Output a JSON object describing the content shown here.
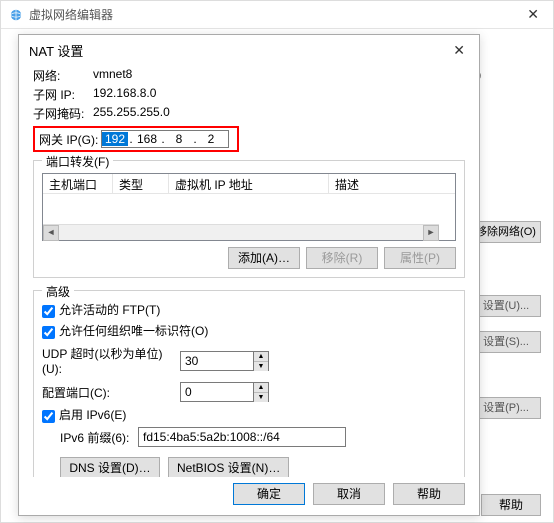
{
  "parent": {
    "title": "虚拟网络编辑器",
    "right_ghost": ".0",
    "btn_remove_net": "移除网络(O)",
    "btn_set_u": "设置(U)...",
    "btn_set_s": "设置(S)...",
    "btn_set_p": "设置(P)...",
    "btn_help": "帮助"
  },
  "modal": {
    "title": "NAT 设置",
    "close": "✕",
    "network_label": "网络:",
    "network_value": "vmnet8",
    "subnet_ip_label": "子网 IP:",
    "subnet_ip_value": "192.168.8.0",
    "subnet_mask_label": "子网掩码:",
    "subnet_mask_value": "255.255.255.0",
    "gateway_label": "网关 IP(G):",
    "gateway_oct1": "192",
    "gateway_oct2": "168",
    "gateway_oct3": "8",
    "gateway_oct4": "2",
    "port_fwd_legend": "端口转发(F)",
    "th_host_port": "主机端口",
    "th_type": "类型",
    "th_vm_ip": "虚拟机 IP 地址",
    "th_desc": "描述",
    "btn_add": "添加(A)…",
    "btn_remove": "移除(R)",
    "btn_props": "属性(P)",
    "adv_legend": "高级",
    "cb_ftp_label": "允许活动的 FTP(T)",
    "cb_oui_label": "允许任何组织唯一标识符(O)",
    "udp_timeout_label": "UDP 超时(以秒为单位)(U):",
    "udp_timeout_value": "30",
    "config_port_label": "配置端口(C):",
    "config_port_value": "0",
    "cb_ipv6_label": "启用 IPv6(E)",
    "ipv6_prefix_label": "IPv6 前缀(6):",
    "ipv6_prefix_value": "fd15:4ba5:5a2b:1008::/64",
    "btn_dns": "DNS 设置(D)…",
    "btn_netbios": "NetBIOS 设置(N)…",
    "btn_ok": "确定",
    "btn_cancel": "取消",
    "btn_help": "帮助"
  }
}
